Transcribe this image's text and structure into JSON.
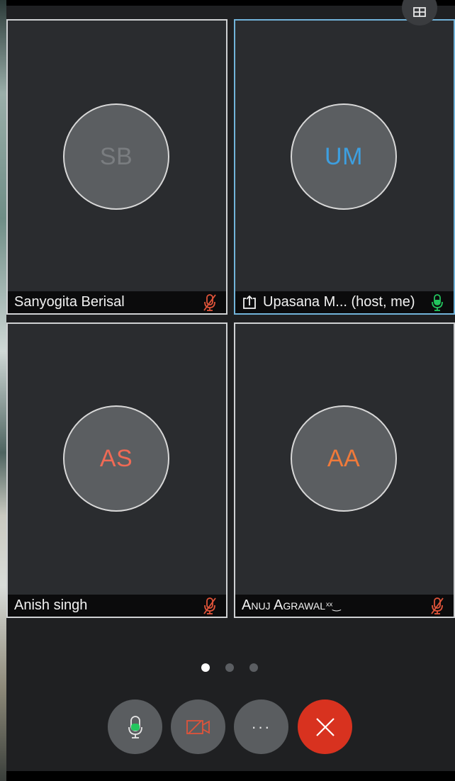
{
  "participants": [
    {
      "initials": "SB",
      "name": "Sanyogita Berisal",
      "initials_color": "#7a7d80",
      "mic": "muted"
    },
    {
      "initials": "UM",
      "name": "Upasana M... (host, me)",
      "initials_color": "#3d9fe0",
      "mic": "active",
      "sharing": true
    },
    {
      "initials": "AS",
      "name": "Anish singh",
      "initials_color": "#f06a55",
      "mic": "muted"
    },
    {
      "initials": "AA",
      "name": "Anuj Agrawal",
      "name_suffix": "ˣˣ‿",
      "initials_color": "#f07a3a",
      "mic": "muted"
    }
  ],
  "pagination": {
    "pages": 3,
    "current": 1
  },
  "controls": {
    "mic": "microphone-icon",
    "video": "video-off-icon",
    "more_label": "···",
    "end": "end-call-icon"
  },
  "colors": {
    "muted_mic": "#e0543a",
    "active_mic": "#23c55e",
    "end_call": "#d8321f",
    "active_border": "#72b4da"
  }
}
